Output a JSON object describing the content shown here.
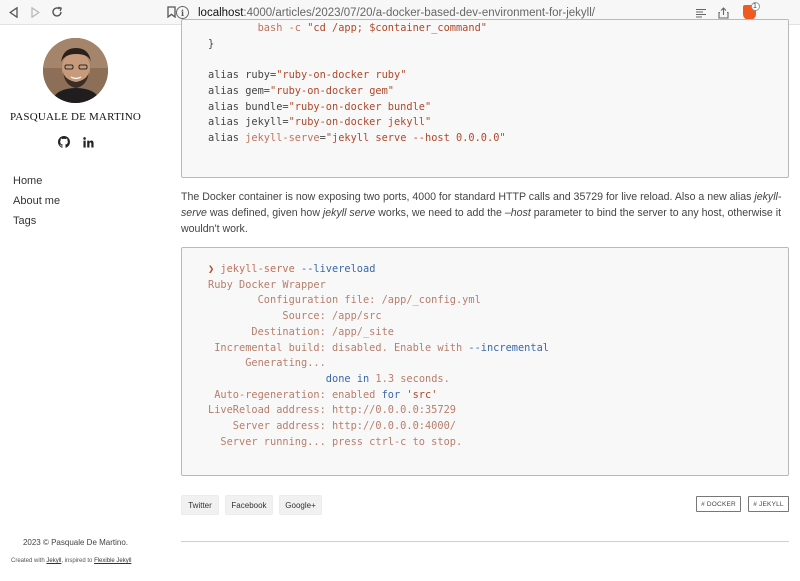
{
  "browser": {
    "url_host": "localhost",
    "url_path": ":4000/articles/2023/07/20/a-docker-based-dev-environment-for-jekyll/",
    "shield_count": "1"
  },
  "sidebar": {
    "author_name": "PASQUALE DE MARTINO",
    "nav": [
      {
        "label": "Home"
      },
      {
        "label": "About me"
      },
      {
        "label": "Tags"
      }
    ],
    "copyright": "2023 © Pasquale De Martino.",
    "credits_prefix": "Created with ",
    "credits_jekyll": "Jekyll",
    "credits_middle": ", inspired to ",
    "credits_theme": "Flexible Jekyll"
  },
  "code_block_1": {
    "lines": [
      [
        {
          "t": "        bash -c ",
          "c": "c-kw"
        },
        {
          "t": "\"cd /app; $container_command\"",
          "c": "c-str"
        }
      ],
      [
        {
          "t": "}",
          "c": "c-default"
        }
      ],
      [
        {
          "t": "",
          "c": "c-default"
        }
      ],
      [
        {
          "t": "alias ruby=",
          "c": "c-default"
        },
        {
          "t": "\"ruby-on-docker ruby\"",
          "c": "c-str"
        }
      ],
      [
        {
          "t": "alias gem=",
          "c": "c-default"
        },
        {
          "t": "\"ruby-on-docker gem\"",
          "c": "c-str"
        }
      ],
      [
        {
          "t": "alias bundle=",
          "c": "c-default"
        },
        {
          "t": "\"ruby-on-docker bundle\"",
          "c": "c-str"
        }
      ],
      [
        {
          "t": "alias jekyll=",
          "c": "c-default"
        },
        {
          "t": "\"ruby-on-docker jekyll\"",
          "c": "c-str"
        }
      ],
      [
        {
          "t": "alias ",
          "c": "c-default"
        },
        {
          "t": "jekyll-serve",
          "c": "c-kw"
        },
        {
          "t": "=",
          "c": "c-default"
        },
        {
          "t": "\"jekyll serve --host 0.0.0.0\"",
          "c": "c-str"
        }
      ]
    ]
  },
  "paragraph": {
    "p1": "The Docker container is now exposing two ports, 4000 for standard HTTP calls and 35729 for live reload. Also a new alias ",
    "em1": "jekyll-serve",
    "p2": " was defined, given how ",
    "em2": "jekyll serve",
    "p3": " works, we need to add the ",
    "em3": "–host",
    "p4": " parameter to bind the server to any host, otherwise it wouldn't work."
  },
  "code_block_2": {
    "lines": [
      [
        {
          "t": "❯ ",
          "c": "c-str"
        },
        {
          "t": "jekyll-serve",
          "c": "c-kw"
        },
        {
          "t": " --livereload",
          "c": "c-blue"
        }
      ],
      [
        {
          "t": "Ruby Docker Wrapper",
          "c": "c-fade"
        }
      ],
      [
        {
          "t": "        Configuration file: /app/_config.yml",
          "c": "c-fade"
        }
      ],
      [
        {
          "t": "            Source: /app/src",
          "c": "c-fade"
        }
      ],
      [
        {
          "t": "       Destination: /app/_site",
          "c": "c-fade"
        }
      ],
      [
        {
          "t": " Incremental build: disabled. Enable with ",
          "c": "c-fade"
        },
        {
          "t": "--incremental",
          "c": "c-blue"
        }
      ],
      [
        {
          "t": "      Generating...",
          "c": "c-fade"
        }
      ],
      [
        {
          "t": "                   ",
          "c": "c-fade"
        },
        {
          "t": "done",
          "c": "c-blue"
        },
        {
          "t": " ",
          "c": "c-fade"
        },
        {
          "t": "in",
          "c": "c-blue"
        },
        {
          "t": " 1.3 seconds.",
          "c": "c-fade"
        }
      ],
      [
        {
          "t": " Auto-regeneration: enabled ",
          "c": "c-fade"
        },
        {
          "t": "for",
          "c": "c-blue"
        },
        {
          "t": " ",
          "c": "c-fade"
        },
        {
          "t": "'src'",
          "c": "c-str"
        }
      ],
      [
        {
          "t": "LiveReload address: http://0.0.0.0:35729",
          "c": "c-fade"
        }
      ],
      [
        {
          "t": "    Server address: http://0.0.0.0:4000/",
          "c": "c-fade"
        }
      ],
      [
        {
          "t": "  Server running... press ctrl-c to stop.",
          "c": "c-fade"
        }
      ]
    ]
  },
  "share": {
    "twitter": "Twitter",
    "facebook": "Facebook",
    "google": "Google+"
  },
  "tags": [
    {
      "label": "# DOCKER"
    },
    {
      "label": "# JEKYLL"
    }
  ]
}
